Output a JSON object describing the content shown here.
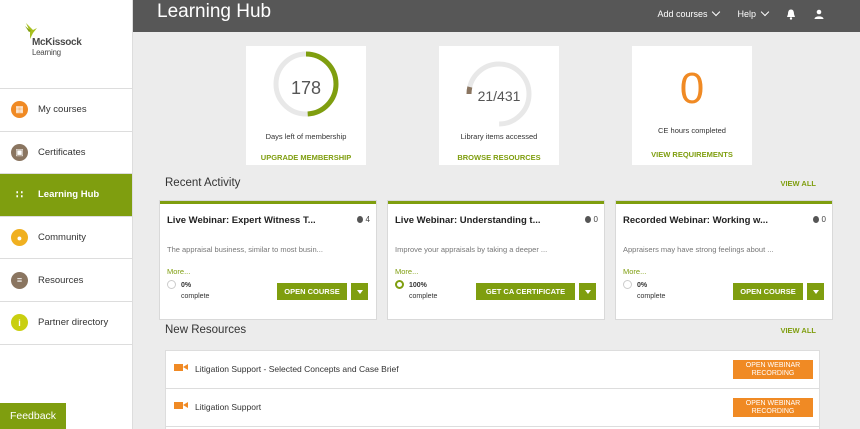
{
  "brand": {
    "name": "McKissock",
    "sub": "Learning"
  },
  "sidebar": {
    "items": [
      {
        "label": "My courses",
        "icon": "book-icon",
        "color": "#f08a24"
      },
      {
        "label": "Certificates",
        "icon": "certificate-icon",
        "color": "#8a7560"
      },
      {
        "label": "Learning Hub",
        "icon": "hub-icon",
        "color": "#7f9e0f"
      },
      {
        "label": "Community",
        "icon": "people-icon",
        "color": "#f0b020"
      },
      {
        "label": "Resources",
        "icon": "stack-icon",
        "color": "#8a7560"
      },
      {
        "label": "Partner directory",
        "icon": "info-icon",
        "color": "#c9cf10"
      }
    ],
    "feedback": "Feedback"
  },
  "header": {
    "title": "Learning Hub",
    "add_courses": "Add courses",
    "help": "Help"
  },
  "stats": [
    {
      "value": "178",
      "label": "Days left of membership",
      "link": "UPGRADE MEMBERSHIP",
      "progress": 0.49
    },
    {
      "value": "21/431",
      "label": "Library items accessed",
      "link": "BROWSE RESOURCES",
      "progress": 0.05
    },
    {
      "value": "0",
      "label": "CE hours completed",
      "link": "VIEW REQUIREMENTS"
    }
  ],
  "recent": {
    "title": "Recent Activity",
    "view_all": "VIEW ALL",
    "cards": [
      {
        "title": "Live Webinar: Expert Witness T...",
        "count": "4",
        "desc": "The appraisal business, similar to most busin...",
        "more": "More...",
        "pct": "0%",
        "complete": "complete",
        "button": "OPEN COURSE"
      },
      {
        "title": "Live Webinar: Understanding t...",
        "count": "0",
        "desc": "Improve your appraisals by taking a deeper ...",
        "more": "More...",
        "pct": "100%",
        "complete": "complete",
        "button": "GET CA CERTIFICATE"
      },
      {
        "title": "Recorded Webinar: Working w...",
        "count": "0",
        "desc": "Appraisers may have strong feelings about ...",
        "more": "More...",
        "pct": "0%",
        "complete": "complete",
        "button": "OPEN COURSE"
      }
    ]
  },
  "resources": {
    "title": "New Resources",
    "view_all": "VIEW ALL",
    "items": [
      {
        "title": "Litigation Support - Selected Concepts and Case Brief",
        "button": "OPEN WEBINAR\nRECORDING"
      },
      {
        "title": "Litigation Support",
        "button": "OPEN WEBINAR\nRECORDING"
      }
    ]
  },
  "colors": {
    "accent": "#7f9e0f",
    "orange": "#f08a24",
    "topbar": "#575757"
  }
}
